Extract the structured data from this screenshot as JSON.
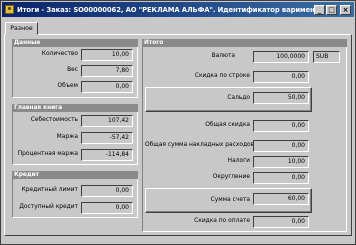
{
  "window": {
    "title": "Итоги - Заказ: SO00000062, АО \"РЕКЛАМА АЛЬФА\". Идентификатор варимент...",
    "icon": "document-icon",
    "buttons": {
      "minimize": "_",
      "maximize": "□",
      "close": "×"
    }
  },
  "tabs": [
    {
      "label": "Разное"
    }
  ],
  "left": {
    "quantities": {
      "header": "Данные",
      "rows": [
        {
          "label": "Количество",
          "value": "10,00"
        },
        {
          "label": "Вес",
          "value": "7,80"
        },
        {
          "label": "Объем",
          "value": "0,00"
        }
      ]
    },
    "margin": {
      "header": "Главная книга",
      "rows": [
        {
          "label": "Себестоимость",
          "value": "107,42"
        },
        {
          "label": "Маржа",
          "value": "-57,42"
        },
        {
          "label": "Процентная маржа",
          "value": "-114,84"
        }
      ]
    },
    "credit": {
      "header": "Кредит",
      "rows": [
        {
          "label": "Кредитный лимит",
          "value": "0,00"
        },
        {
          "label": "Доступный кредит",
          "value": "0,00"
        }
      ]
    }
  },
  "right": {
    "header": "Итого",
    "amount": {
      "label": "Валюта",
      "value": "100,0000",
      "currency": "SUB"
    },
    "line_discount": {
      "label": "Скидка по строке",
      "value": "0,00"
    },
    "balance": {
      "label": "Сальдо",
      "value": "50,00"
    },
    "total_discount": {
      "label": "Общая скидка",
      "value": "0,00"
    },
    "misc_charges": {
      "label": "Общая сумма накладных расходов",
      "value": "0,00"
    },
    "taxes": {
      "label": "Налоги",
      "value": "10,00"
    },
    "round_off": {
      "label": "Округление",
      "value": "0,00"
    },
    "invoice_total": {
      "label": "Сумма счета",
      "value": "60,00"
    },
    "settle_discount": {
      "label": "Скидка по оплате",
      "value": "0,00"
    }
  }
}
